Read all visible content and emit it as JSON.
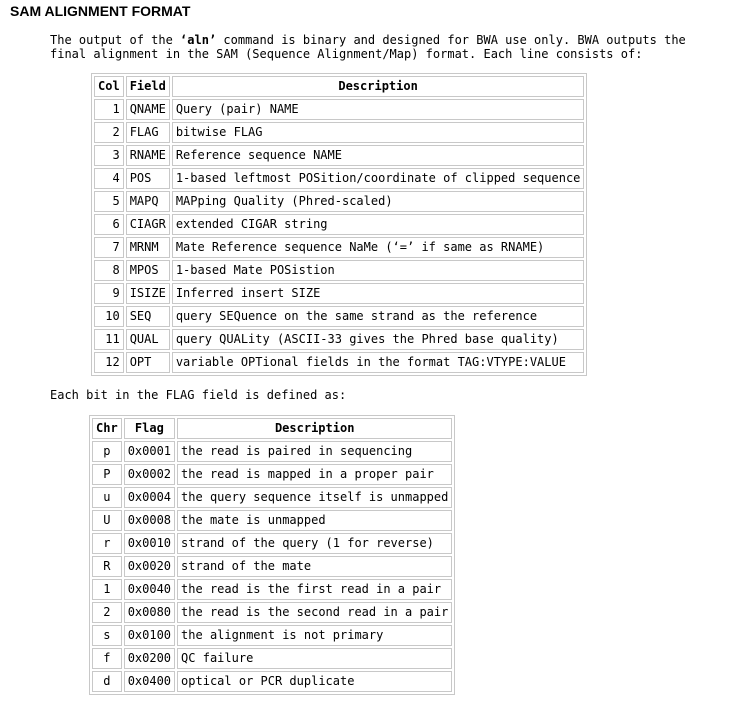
{
  "title": "SAM ALIGNMENT FORMAT",
  "intro": {
    "before": "The output of the ",
    "command": "‘aln’",
    "after": " command is binary and designed for BWA use only. BWA outputs the final alignment in the SAM (Sequence Alignment/Map) format. Each line consists of:"
  },
  "fields_table": {
    "headers": [
      "Col",
      "Field",
      "Description"
    ],
    "rows": [
      {
        "col": "1",
        "field": "QNAME",
        "desc": "Query (pair) NAME"
      },
      {
        "col": "2",
        "field": "FLAG",
        "desc": "bitwise FLAG"
      },
      {
        "col": "3",
        "field": "RNAME",
        "desc": "Reference sequence NAME"
      },
      {
        "col": "4",
        "field": "POS",
        "desc": "1-based leftmost POSition/coordinate of clipped sequence"
      },
      {
        "col": "5",
        "field": "MAPQ",
        "desc": "MAPping Quality (Phred-scaled)"
      },
      {
        "col": "6",
        "field": "CIAGR",
        "desc": "extended CIGAR string"
      },
      {
        "col": "7",
        "field": "MRNM",
        "desc": "Mate Reference sequence NaMe (‘=’ if same as RNAME)"
      },
      {
        "col": "8",
        "field": "MPOS",
        "desc": "1-based Mate POSistion"
      },
      {
        "col": "9",
        "field": "ISIZE",
        "desc": "Inferred insert SIZE"
      },
      {
        "col": "10",
        "field": "SEQ",
        "desc": "query SEQuence on the same strand as the reference"
      },
      {
        "col": "11",
        "field": "QUAL",
        "desc": "query QUALity (ASCII-33 gives the Phred base quality)"
      },
      {
        "col": "12",
        "field": "OPT",
        "desc": "variable OPTional fields in the format TAG:VTYPE:VALUE"
      }
    ]
  },
  "flag_intro": "Each bit in the FLAG field is defined as:",
  "flags_table": {
    "headers": [
      "Chr",
      "Flag",
      "Description"
    ],
    "rows": [
      {
        "chr": "p",
        "flag": "0x0001",
        "desc": "the read is paired in sequencing"
      },
      {
        "chr": "P",
        "flag": "0x0002",
        "desc": "the read is mapped in a proper pair"
      },
      {
        "chr": "u",
        "flag": "0x0004",
        "desc": "the query sequence itself is unmapped"
      },
      {
        "chr": "U",
        "flag": "0x0008",
        "desc": "the mate is unmapped"
      },
      {
        "chr": "r",
        "flag": "0x0010",
        "desc": "strand of the query (1 for reverse)"
      },
      {
        "chr": "R",
        "flag": "0x0020",
        "desc": "strand of the mate"
      },
      {
        "chr": "1",
        "flag": "0x0040",
        "desc": "the read is the first read in a pair"
      },
      {
        "chr": "2",
        "flag": "0x0080",
        "desc": "the read is the second read in a pair"
      },
      {
        "chr": "s",
        "flag": "0x0100",
        "desc": "the alignment is not primary"
      },
      {
        "chr": "f",
        "flag": "0x0200",
        "desc": "QC failure"
      },
      {
        "chr": "d",
        "flag": "0x0400",
        "desc": "optical or PCR duplicate"
      }
    ]
  }
}
